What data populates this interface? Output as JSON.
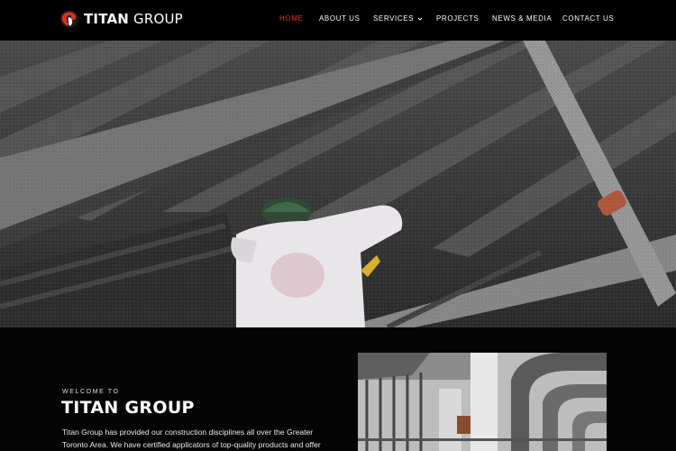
{
  "brand": {
    "name_bold": "TITAN",
    "name_light": " GROUP",
    "logo_icon": "ram-head-icon",
    "accent_color": "#e03a32"
  },
  "nav": {
    "items": [
      {
        "label": "HOME",
        "active": true
      },
      {
        "label": "ABOUT US",
        "active": false
      },
      {
        "label": "SERVICES",
        "active": false,
        "has_dropdown": true
      },
      {
        "label": "PROJECTS",
        "active": false
      },
      {
        "label": "NEWS & MEDIA",
        "active": false
      },
      {
        "label": "CONTACT US",
        "active": false
      }
    ],
    "dropdown_icon": "chevron-down-icon"
  },
  "hero": {
    "image": "worker spraying fireproofing on ceiling beams"
  },
  "intro": {
    "eyebrow": "WELCOME TO",
    "title": "TITAN GROUP",
    "body_line1": "Titan Group has provided our construction disciplines all over the Greater",
    "body_line2": "Toronto Area. We have certified applicators of top-quality products and offer"
  },
  "side_photo": {
    "image": "building interior with scaffolding and curved structures"
  }
}
